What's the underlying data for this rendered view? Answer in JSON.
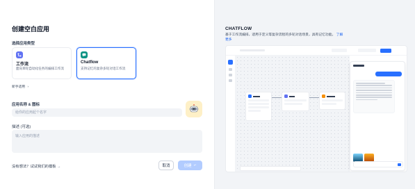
{
  "left": {
    "title": "创建空白应用",
    "app_type_label": "选择应用类型",
    "types": [
      {
        "name": "工作流",
        "desc": "面向单轮自动化任务的编排工作流",
        "icon": "workflow-icon",
        "color": "#6172f3"
      },
      {
        "name": "Chatflow",
        "desc": "支持记忆的复杂多轮对话工作流",
        "icon": "chatflow-icon",
        "color": "#0e9384"
      }
    ],
    "beginner_label": "新手适用",
    "name_icon_label": "应用名称 & 图标",
    "name_placeholder": "给你的应用起个名字",
    "description_label": "描述 (可选)",
    "description_placeholder": "输入应用的描述",
    "template_link": "没有想法？试试我们的模板",
    "cancel_label": "取消",
    "create_label": "创建"
  },
  "right": {
    "heading": "CHATFLOW",
    "description": "基于工作流编排，适用于定义等复杂流程的多轮对话场景，具有记忆功能。",
    "learn_more": "了解更多"
  },
  "colors": {
    "accent": "#2970ff",
    "selected_border": "#2970ff",
    "create_disabled": "#b2ccff"
  }
}
